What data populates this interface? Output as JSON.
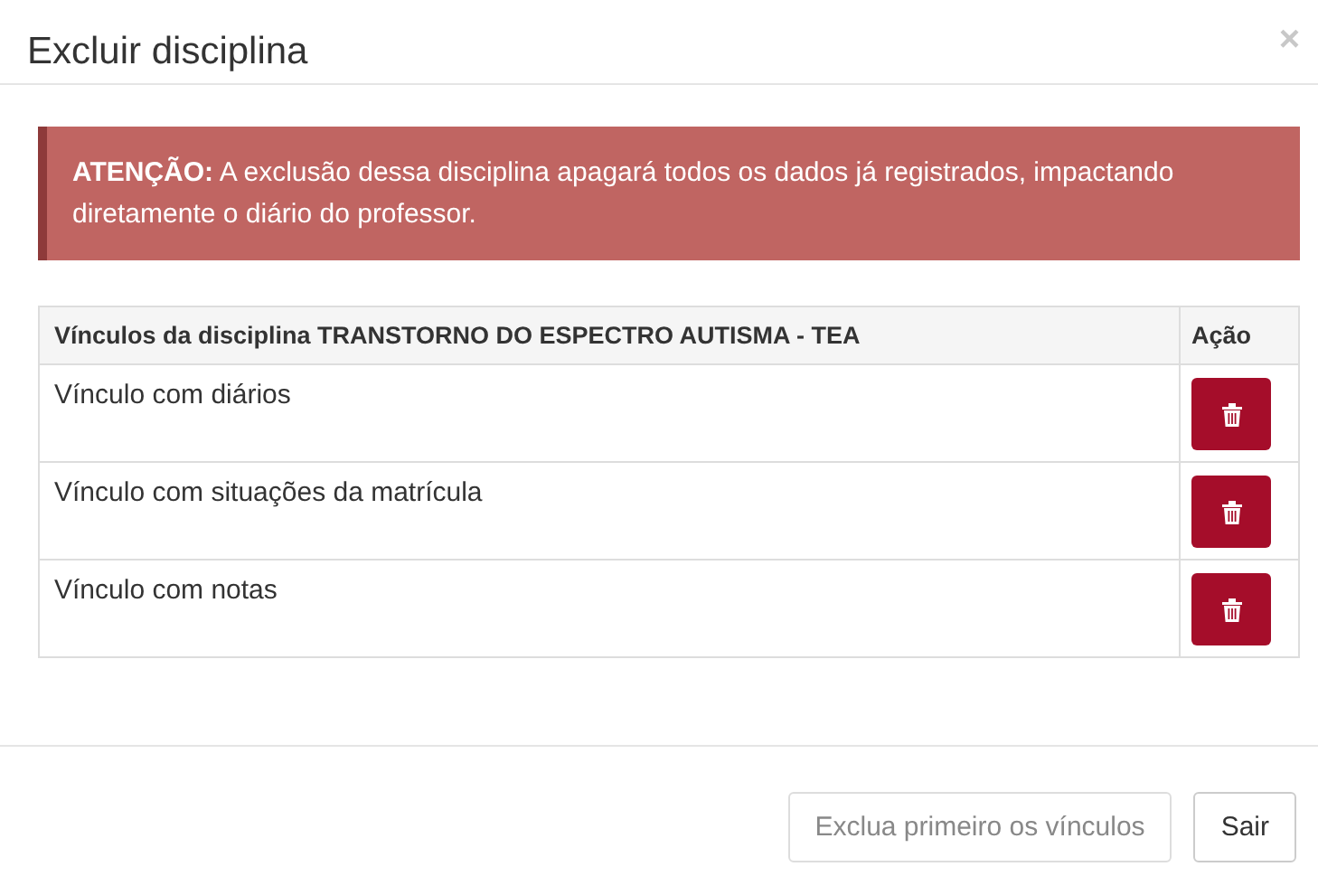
{
  "dialog": {
    "title": "Excluir disciplina",
    "close": "×"
  },
  "alert": {
    "text": "**ATENÇÃO:** A exclusão dessa disciplina apagará todos os dados já registrados, impactando diretamente o diário do professor."
  },
  "table": {
    "columns": [
      "Vínculos da disciplina TRANSTORNO DO ESPECTRO AUTISMA - TEA",
      "Ação"
    ],
    "rows": [
      {
        "label": "Vínculo com diários"
      },
      {
        "label": "Vínculo com situações da matrícula"
      },
      {
        "label": "Vínculo com notas"
      }
    ]
  },
  "buttons": [
    {
      "label": "Exclua primeiro os vínculos",
      "disabled": true
    },
    {
      "label": "Sair",
      "disabled": false
    }
  ]
}
